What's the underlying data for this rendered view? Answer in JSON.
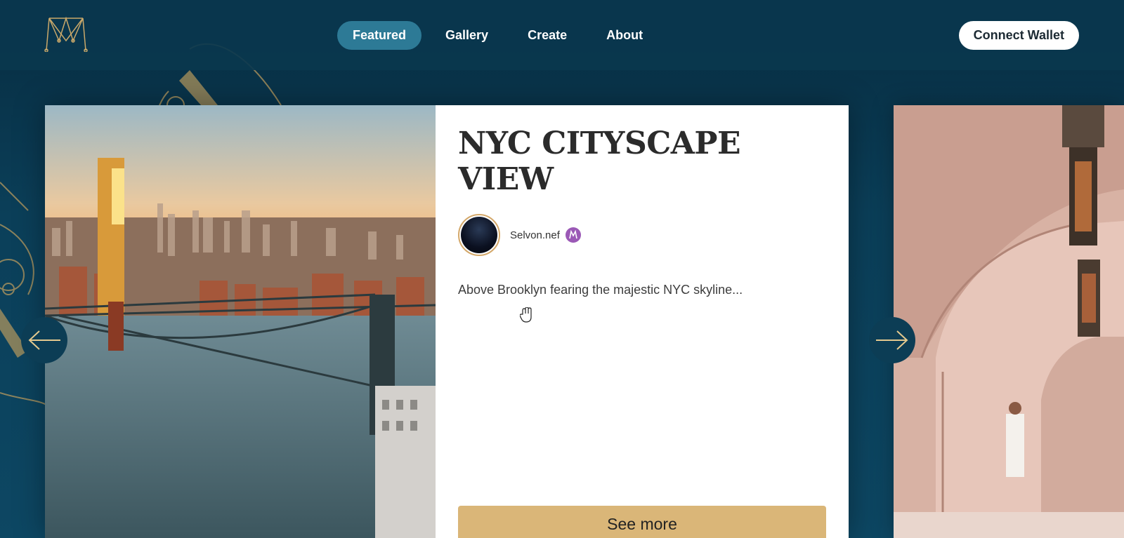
{
  "header": {
    "logo_name": "logo",
    "nav": [
      {
        "label": "Featured",
        "active": true
      },
      {
        "label": "Gallery",
        "active": false
      },
      {
        "label": "Create",
        "active": false
      },
      {
        "label": "About",
        "active": false
      }
    ],
    "connect_label": "Connect Wallet"
  },
  "featured": {
    "title": "NYC CITYSCAPE VIEW",
    "creator": "Selvon.nef",
    "description": "Above Brooklyn fearing the majestic NYC skyline...",
    "cta": "See more"
  },
  "colors": {
    "background": "#0b3f59",
    "nav_active": "#2d7a96",
    "accent_gold": "#dab678",
    "verified": "#9b59b6"
  },
  "icons": [
    "arrow-left-icon",
    "arrow-right-icon",
    "verified-icon",
    "hand-cursor-icon"
  ]
}
